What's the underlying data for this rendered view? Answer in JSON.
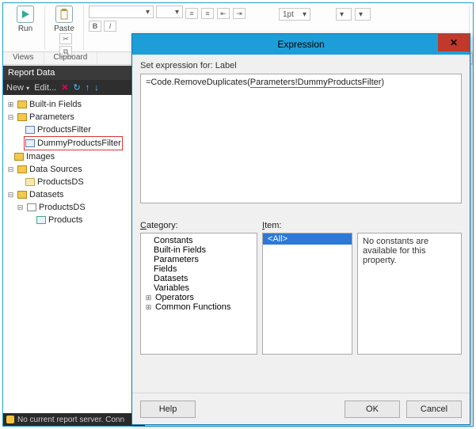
{
  "ribbon": {
    "run_label": "Run",
    "paste_label": "Paste",
    "views_label": "Views",
    "clipboard_label": "Clipboard",
    "bold": "B",
    "italic": "I",
    "ptsize": "1pt",
    "caret": "▾"
  },
  "reportData": {
    "title": "Report Data",
    "new": "New",
    "edit": "Edit...",
    "delete_icon": "✕",
    "refresh_icon": "↻",
    "up_icon": "↑",
    "down_icon": "↓",
    "tree": {
      "builtin": "Built-in Fields",
      "parameters": "Parameters",
      "p1": "ProductsFilter",
      "p2": "DummyProductsFilter",
      "images": "Images",
      "datasources": "Data Sources",
      "ds1": "ProductsDS",
      "datasets": "Datasets",
      "dset1": "ProductsDS",
      "dcol1": "Products"
    },
    "status": "No current report server.  Conn"
  },
  "dialog": {
    "title": "Expression",
    "set_for": "Set expression for: Label",
    "expr_prefix": "=Code.RemoveDuplicates(",
    "expr_hl": "Parameters!DummyProductsFilter",
    "expr_suffix": ")",
    "category_label": "Category:",
    "item_label": "Item:",
    "categories": {
      "c1": "Constants",
      "c2": "Built-in Fields",
      "c3": "Parameters",
      "c4": "Fields",
      "c5": "Datasets",
      "c6": "Variables",
      "c7": "Operators",
      "c8": "Common Functions"
    },
    "item_all": "<All>",
    "desc": "No constants are available for this property.",
    "help": "Help",
    "ok": "OK",
    "cancel": "Cancel"
  }
}
